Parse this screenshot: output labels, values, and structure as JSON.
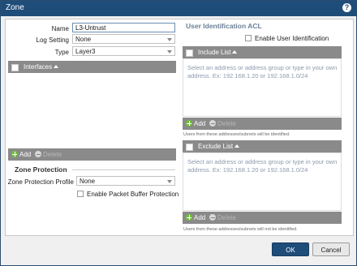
{
  "dialog": {
    "title": "Zone"
  },
  "form": {
    "name_label": "Name",
    "name_value": "L3-Untrust",
    "log_label": "Log Setting",
    "log_value": "None",
    "type_label": "Type",
    "type_value": "Layer3"
  },
  "interfaces": {
    "header": "Interfaces",
    "add": "Add",
    "delete": "Delete"
  },
  "zone_protection": {
    "title": "Zone Protection",
    "profile_label": "Zone Protection Profile",
    "profile_value": "None",
    "buffer_label": "Enable Packet Buffer Protection"
  },
  "user_id": {
    "title": "User Identification ACL",
    "enable_label": "Enable User Identification",
    "include": {
      "header": "Include List",
      "placeholder": "Select an address or address group or type in your own address. Ex: 192.168.1.20 or 192.168.1.0/24",
      "add": "Add",
      "delete": "Delete",
      "note": "Users from these addresses/subnets will be identified."
    },
    "exclude": {
      "header": "Exclude List",
      "placeholder": "Select an address or address group or type in your own address. Ex: 192.168.1.20 or 192.168.1.0/24",
      "add": "Add",
      "delete": "Delete",
      "note": "Users from these addresses/subnets will not be identified."
    }
  },
  "buttons": {
    "ok": "OK",
    "cancel": "Cancel"
  }
}
